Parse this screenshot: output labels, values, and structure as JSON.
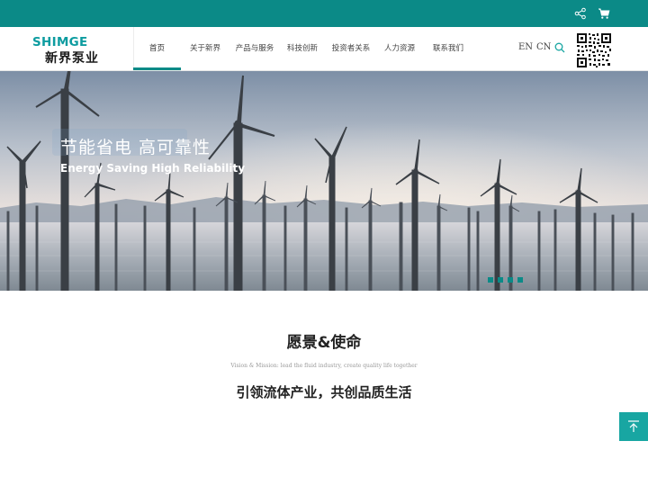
{
  "topbar": {
    "icons": [
      "share-icon",
      "cart-icon"
    ],
    "color": "#0b8a87"
  },
  "brand": {
    "logo_en": "SHIMGE",
    "logo_cn": "新界泵业",
    "color": "#0d9ca0"
  },
  "nav": {
    "items": [
      {
        "label": "首页",
        "active": true
      },
      {
        "label": "关于新界",
        "active": false
      },
      {
        "label": "产品与服务",
        "active": false
      },
      {
        "label": "科技创新",
        "active": false
      },
      {
        "label": "投资者关系",
        "active": false
      },
      {
        "label": "人力资源",
        "active": false
      },
      {
        "label": "联系我们",
        "active": false
      }
    ],
    "lang_en": "EN",
    "lang_cn": "CN",
    "search_icon": "search-icon",
    "qr_icon": "qr-code"
  },
  "hero": {
    "title": "节能省电 高可靠性",
    "subtitle": "Energy Saving  High Reliability",
    "slides_total": 4,
    "active_slide": 1
  },
  "vision": {
    "title": "愿景&使命",
    "subtitle": "Vision & Mission: lead the fluid industry, create quality life together",
    "slogan": "引领流体产业，共创品质生活"
  },
  "back_to_top": {
    "icon": "arrow-up-icon",
    "color": "#18a6a2"
  }
}
